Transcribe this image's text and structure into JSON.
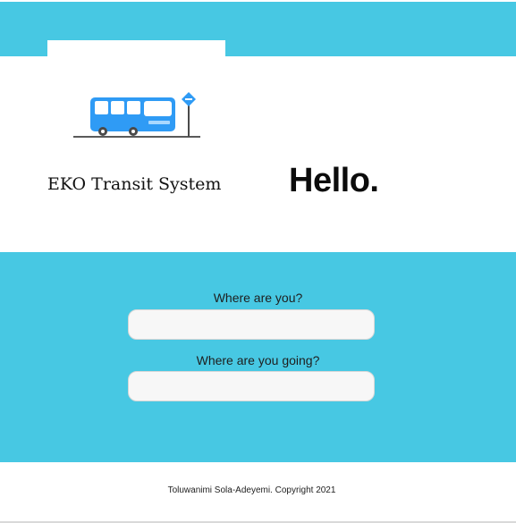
{
  "brand": {
    "name": "EKO Transit System",
    "logo_icon": "bus-stop-icon"
  },
  "hero": {
    "greeting": "Hello."
  },
  "form": {
    "origin_label": "Where are you?",
    "origin_value": "",
    "destination_label": "Where are you going?",
    "destination_value": ""
  },
  "footer": {
    "text": "Toluwanimi Sola-Adeyemi. Copyright 2021"
  },
  "colors": {
    "band": "#47c8e3",
    "bus": "#2f9bf5",
    "field": "#f7f7f7"
  }
}
